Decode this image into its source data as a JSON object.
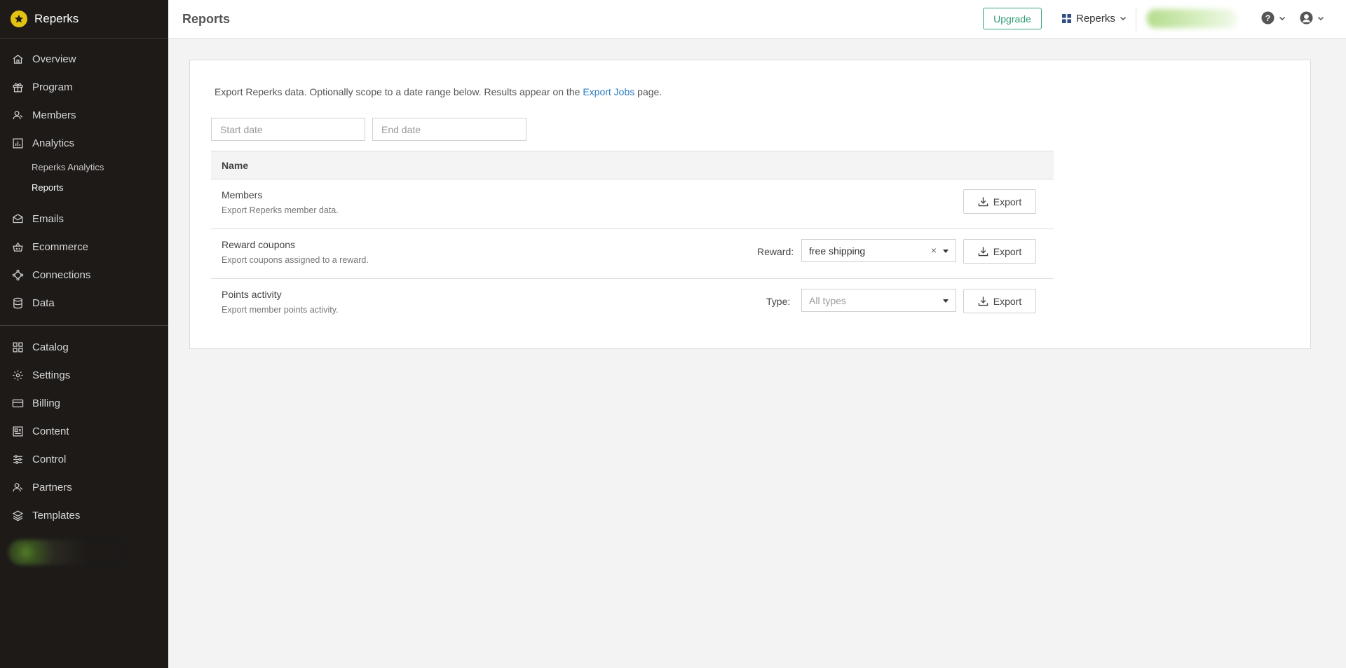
{
  "app": {
    "name": "Reperks"
  },
  "sidebar": {
    "items": [
      {
        "label": "Overview",
        "icon": "home-icon"
      },
      {
        "label": "Program",
        "icon": "gift-icon"
      },
      {
        "label": "Members",
        "icon": "user-icon"
      },
      {
        "label": "Analytics",
        "icon": "bar-chart-icon"
      }
    ],
    "sub_items": [
      {
        "label": "Reperks Analytics",
        "active": false
      },
      {
        "label": "Reports",
        "active": true
      }
    ],
    "items_2": [
      {
        "label": "Emails",
        "icon": "mail-icon"
      },
      {
        "label": "Ecommerce",
        "icon": "basket-icon"
      },
      {
        "label": "Connections",
        "icon": "connections-icon"
      },
      {
        "label": "Data",
        "icon": "database-icon"
      }
    ],
    "items_3": [
      {
        "label": "Catalog",
        "icon": "grid-icon"
      },
      {
        "label": "Settings",
        "icon": "gear-icon"
      },
      {
        "label": "Billing",
        "icon": "credit-card-icon"
      },
      {
        "label": "Content",
        "icon": "content-icon"
      },
      {
        "label": "Control",
        "icon": "sliders-icon"
      },
      {
        "label": "Partners",
        "icon": "partners-icon"
      },
      {
        "label": "Templates",
        "icon": "layers-icon"
      }
    ]
  },
  "header": {
    "title": "Reports",
    "upgrade_label": "Upgrade",
    "workspace_label": "Reperks"
  },
  "main": {
    "intro_before": "Export Reperks data. Optionally scope to a date range below. Results appear on the ",
    "intro_link": "Export Jobs",
    "intro_after": " page.",
    "start_date_placeholder": "Start date",
    "end_date_placeholder": "End date",
    "table_header": "Name",
    "export_label": "Export",
    "rows": [
      {
        "title": "Members",
        "description": "Export Reperks member data."
      },
      {
        "title": "Reward coupons",
        "description": "Export coupons assigned to a reward.",
        "field_label": "Reward:",
        "select_value": "free shipping"
      },
      {
        "title": "Points activity",
        "description": "Export member points activity.",
        "field_label": "Type:",
        "select_placeholder": "All types"
      }
    ]
  },
  "colors": {
    "sidebar_bg": "#1d1a18",
    "brand_accent": "#e3c312",
    "upgrade_green": "#2f9d73",
    "link_blue": "#2d7cc0"
  }
}
